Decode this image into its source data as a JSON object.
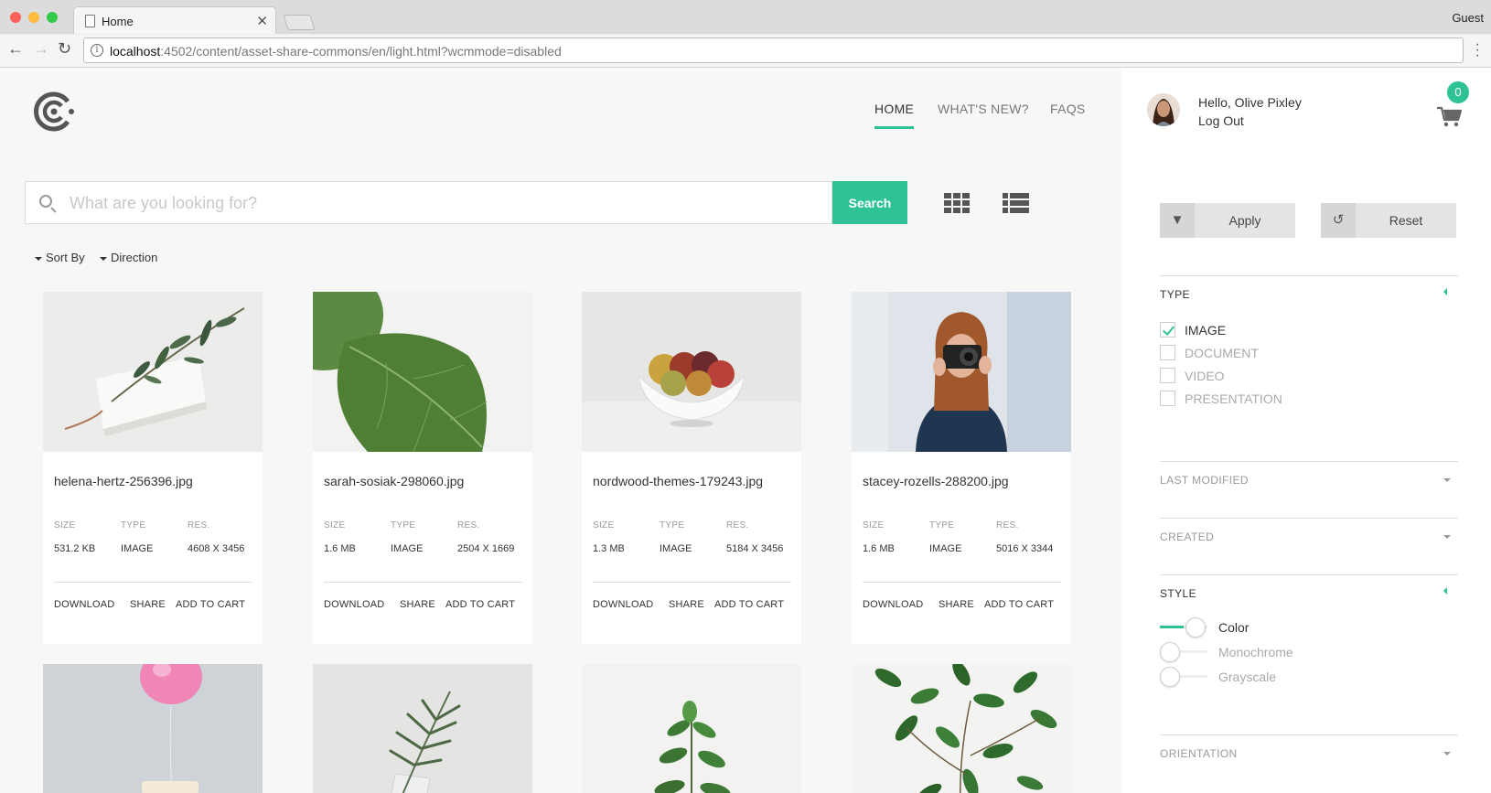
{
  "browser": {
    "tab_title": "Home",
    "profile": "Guest",
    "url_host": "localhost",
    "url_rest": ":4502/content/asset-share-commons/en/light.html?wcmmode=disabled"
  },
  "nav": {
    "home": "HOME",
    "whats_new": "WHAT'S NEW?",
    "faqs": "FAQS"
  },
  "search": {
    "placeholder": "What are you looking for?",
    "button": "Search"
  },
  "sort": {
    "sort_by": "Sort By",
    "direction": "Direction"
  },
  "meta_labels": {
    "size": "SIZE",
    "type": "TYPE",
    "res": "RES."
  },
  "actions": {
    "download": "DOWNLOAD",
    "share": "SHARE",
    "add_to_cart": "ADD TO CART"
  },
  "cards": [
    {
      "filename": "helena-hertz-256396.jpg",
      "size": "531.2 KB",
      "type": "IMAGE",
      "res": "4608 X 3456",
      "image": "leaf-sprig-on-card"
    },
    {
      "filename": "sarah-sosiak-298060.jpg",
      "size": "1.6 MB",
      "type": "IMAGE",
      "res": "2504 X 1669",
      "image": "fiddle-leaf"
    },
    {
      "filename": "nordwood-themes-179243.jpg",
      "size": "1.3 MB",
      "type": "IMAGE",
      "res": "5184 X 3456",
      "image": "fruit-bowl"
    },
    {
      "filename": "stacey-rozells-288200.jpg",
      "size": "1.6 MB",
      "type": "IMAGE",
      "res": "5016 X 3344",
      "image": "woman-with-camera"
    },
    {
      "image": "pink-balloon-chair"
    },
    {
      "image": "fern-in-glass"
    },
    {
      "image": "potted-plant"
    },
    {
      "image": "leafy-branches"
    }
  ],
  "user": {
    "greeting": "Hello, Olive Pixley",
    "logout": "Log Out",
    "cart_count": "0"
  },
  "filters": {
    "apply": "Apply",
    "reset": "Reset",
    "type_title": "TYPE",
    "type_options": [
      {
        "label": "IMAGE",
        "checked": true
      },
      {
        "label": "DOCUMENT",
        "checked": false
      },
      {
        "label": "VIDEO",
        "checked": false
      },
      {
        "label": "PRESENTATION",
        "checked": false
      }
    ],
    "last_modified": "LAST MODIFIED",
    "created": "CREATED",
    "style_title": "STYLE",
    "style_options": [
      {
        "label": "Color",
        "on": true
      },
      {
        "label": "Monochrome",
        "on": false
      },
      {
        "label": "Grayscale",
        "on": false
      }
    ],
    "orientation": "ORIENTATION"
  },
  "colors": {
    "accent": "#2ec296"
  }
}
